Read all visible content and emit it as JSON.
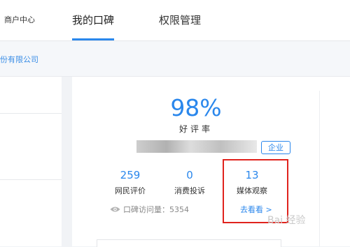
{
  "nav": {
    "merchant_center": "商户中心",
    "my_koubei": "我的口碑",
    "permissions": "权限管理"
  },
  "account": {
    "company_suffix": "份有限公司"
  },
  "rating": {
    "value": "98%",
    "label": "好评率"
  },
  "badge": "企业",
  "stats": [
    {
      "value": "259",
      "label": "网民评价"
    },
    {
      "value": "0",
      "label": "消费投诉"
    },
    {
      "value": "13",
      "label": "媒体观察"
    }
  ],
  "visits": "口碑访问量：5354",
  "view_link": "去看看 >",
  "watermark": "Bai 经验",
  "colors": {
    "accent": "#2a87ec",
    "highlight": "#e0231d"
  }
}
